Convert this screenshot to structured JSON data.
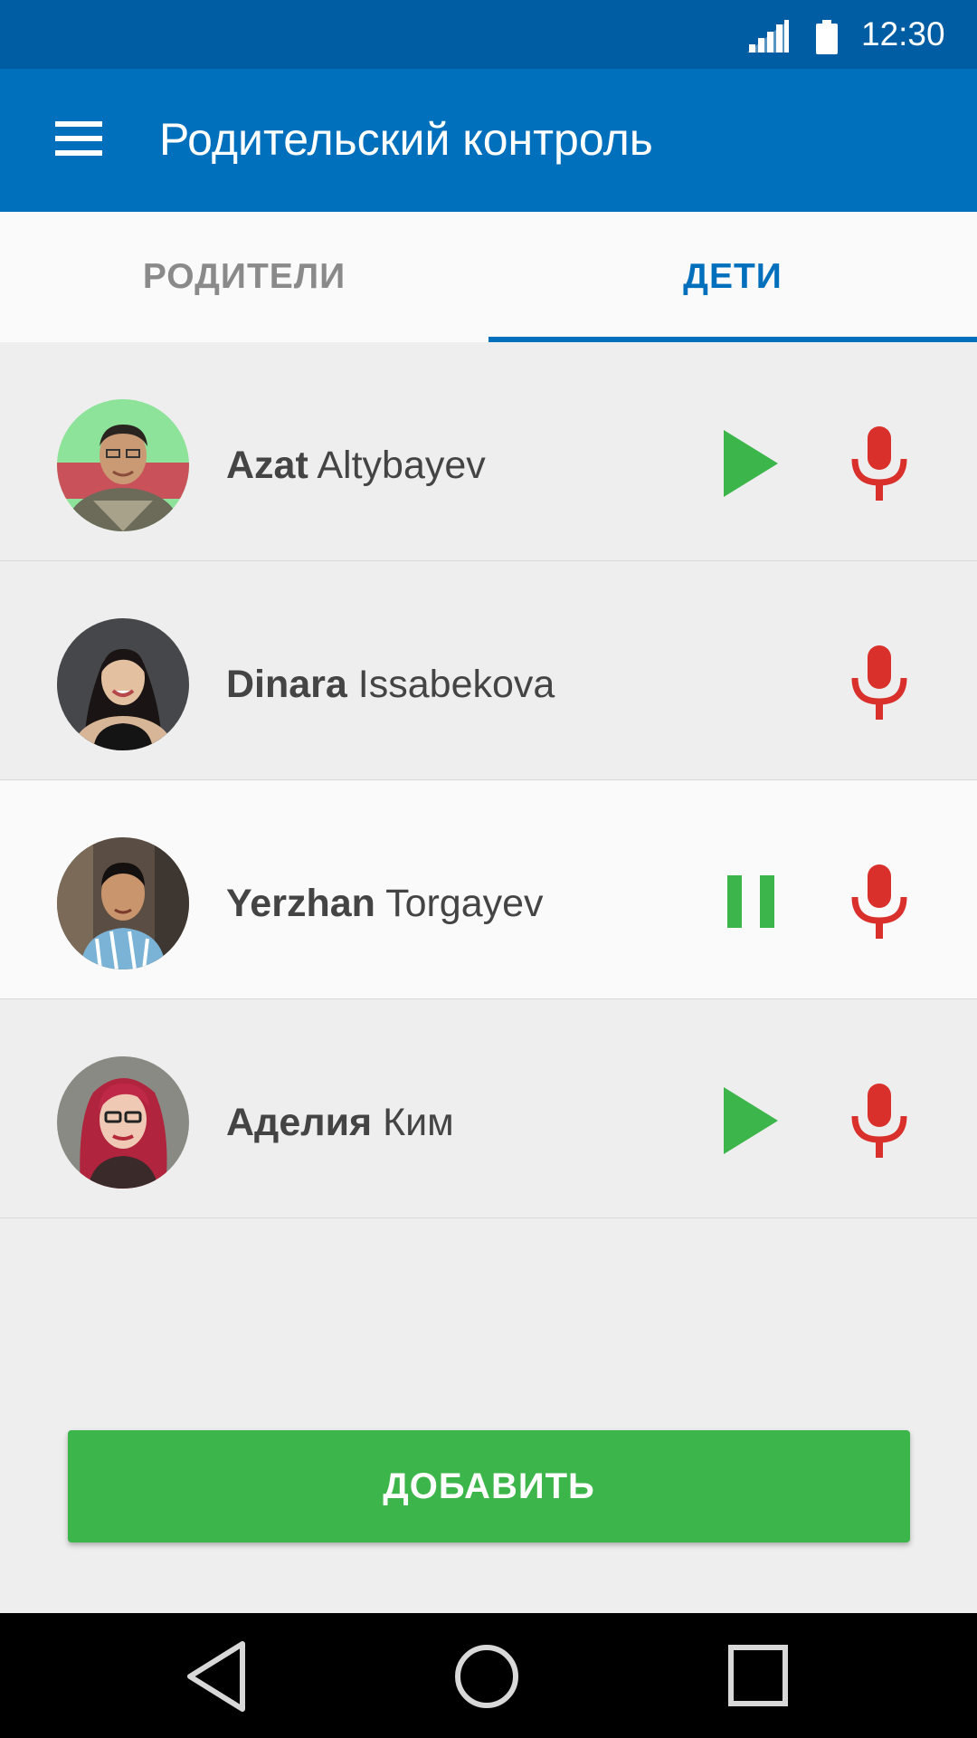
{
  "status_bar": {
    "time": "12:30",
    "icons": [
      "signal-icon",
      "battery-icon"
    ]
  },
  "app_bar": {
    "menu_icon": "menu-icon",
    "title": "Родительский контроль",
    "color": "#0070bd"
  },
  "tabs": [
    {
      "label": "РОДИТЕЛИ",
      "selected": false
    },
    {
      "label": "ДЕТИ",
      "selected": true
    }
  ],
  "children": [
    {
      "first_name": "Azat",
      "last_name": "Altybayev",
      "playback": "play",
      "mic": "microphone-icon",
      "active": false
    },
    {
      "first_name": "Dinara",
      "last_name": "Issabekova",
      "playback": "none",
      "mic": "microphone-icon",
      "active": false
    },
    {
      "first_name": "Yerzhan",
      "last_name": "Torgayev",
      "playback": "pause",
      "mic": "microphone-icon",
      "active": true
    },
    {
      "first_name": "Аделия",
      "last_name": "Ким",
      "playback": "play",
      "mic": "microphone-icon",
      "active": false
    }
  ],
  "add_button": {
    "label": "ДОБАВИТЬ",
    "color": "#3cb54a"
  },
  "colors": {
    "play": "#3cb54a",
    "mic": "#d9302c",
    "accent": "#0070bd"
  },
  "nav_bar": {
    "icons": [
      "back-icon",
      "home-icon",
      "recents-icon"
    ]
  }
}
